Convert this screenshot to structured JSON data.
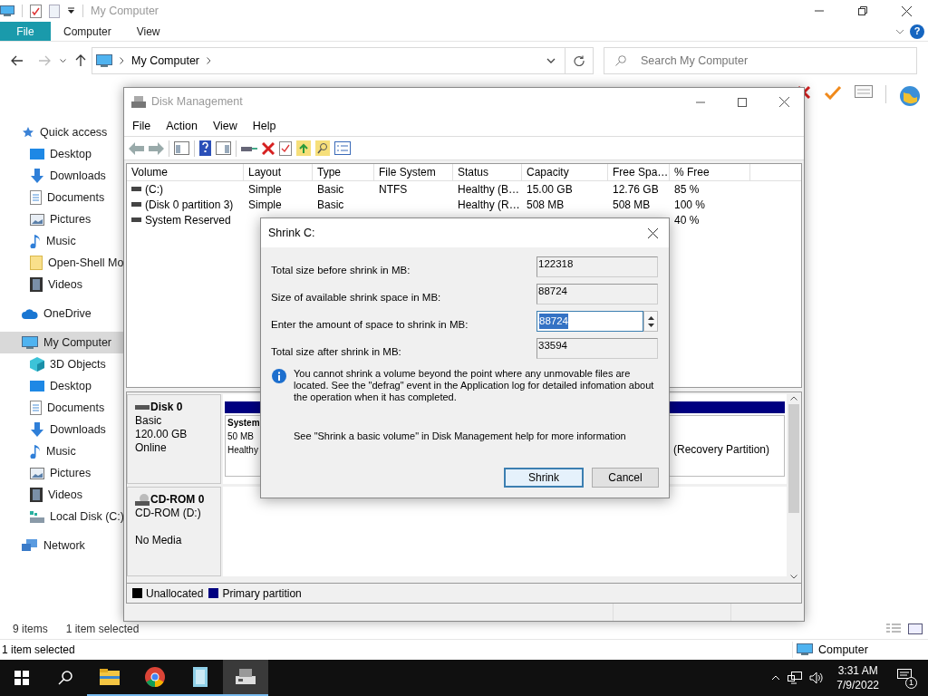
{
  "explorer": {
    "title": "My Computer",
    "ribbon_tabs": [
      {
        "label": "File",
        "selected": true
      },
      {
        "label": "Computer",
        "selected": false
      },
      {
        "label": "View",
        "selected": false
      }
    ],
    "help": "?",
    "address": {
      "path": "My Computer"
    },
    "search": {
      "placeholder": "Search My Computer"
    },
    "nav": [
      {
        "label": "Quick access",
        "selected": false,
        "children": [
          {
            "label": "Desktop",
            "selected": false
          },
          {
            "label": "Downloads",
            "selected": false
          },
          {
            "label": "Documents",
            "selected": false
          },
          {
            "label": "Pictures",
            "selected": false
          },
          {
            "label": "Music",
            "selected": false
          },
          {
            "label": "Open-Shell Mo",
            "selected": false
          },
          {
            "label": "Videos",
            "selected": false
          }
        ]
      },
      {
        "label": "OneDrive",
        "selected": false
      },
      {
        "label": "My Computer",
        "selected": true,
        "children": [
          {
            "label": "3D Objects",
            "selected": false
          },
          {
            "label": "Desktop",
            "selected": false
          },
          {
            "label": "Documents",
            "selected": false
          },
          {
            "label": "Downloads",
            "selected": false
          },
          {
            "label": "Music",
            "selected": false
          },
          {
            "label": "Pictures",
            "selected": false
          },
          {
            "label": "Videos",
            "selected": false
          },
          {
            "label": "Local Disk (C:)",
            "selected": false
          }
        ]
      },
      {
        "label": "Network",
        "selected": false
      }
    ],
    "status": {
      "count": "9 items",
      "selection": "1 item selected"
    }
  },
  "back_window_status": {
    "selection": "1 item selected",
    "location": "Computer"
  },
  "disk_management": {
    "title": "Disk Management",
    "menu": [
      "File",
      "Action",
      "View",
      "Help"
    ],
    "columns": [
      "Volume",
      "Layout",
      "Type",
      "File System",
      "Status",
      "Capacity",
      "Free Spa…",
      "% Free"
    ],
    "rows": [
      {
        "volume": "(C:)",
        "layout": "Simple",
        "type": "Basic",
        "file_system": "NTFS",
        "status": "Healthy (B…",
        "capacity": "15.00 GB",
        "free_space": "12.76 GB",
        "pct_free": "85 %"
      },
      {
        "volume": "(Disk 0 partition 3)",
        "layout": "Simple",
        "type": "Basic",
        "status": "Healthy (R…",
        "capacity": "508 MB",
        "free_space": "508 MB",
        "pct_free": "100 %"
      },
      {
        "volume": "System Reserved",
        "pct_free": "40 %"
      }
    ],
    "disks": [
      {
        "kind": "disk",
        "name": "Disk 0",
        "type": "Basic",
        "size": "120.00 GB",
        "status": "Online",
        "partitions": [
          {
            "name": "System",
            "size": "50 MB",
            "status": "Healthy"
          },
          {
            "status": "(Recovery Partition)"
          }
        ]
      },
      {
        "kind": "cdrom",
        "name": "CD-ROM 0",
        "type": "CD-ROM (D:)",
        "status": "No Media"
      }
    ],
    "legend": [
      {
        "label": "Unallocated",
        "color": "#000000"
      },
      {
        "label": "Primary partition",
        "color": "#000080"
      }
    ]
  },
  "shrink_dialog": {
    "title": "Shrink C:",
    "fields": [
      {
        "label": "Total size before shrink in MB:",
        "value": "122318",
        "kind": "readonly"
      },
      {
        "label": "Size of available shrink space in MB:",
        "value": "88724",
        "kind": "readonly"
      },
      {
        "label": "Enter the amount of space to shrink in MB:",
        "value": "88724",
        "kind": "spin"
      },
      {
        "label": "Total size after shrink in MB:",
        "value": "33594",
        "kind": "readonly"
      }
    ],
    "info": "You cannot shrink a volume beyond the point where any unmovable files are located. See the \"defrag\" event in the Application log for detailed infomation about the operation when it has completed.",
    "help": "See \"Shrink a basic volume\" in Disk Management help for more information",
    "buttons": [
      {
        "label": "Shrink",
        "default": true
      },
      {
        "label": "Cancel",
        "default": false
      }
    ]
  },
  "taskbar": {
    "time": "3:31 AM",
    "date": "7/9/2022",
    "notifications": "1"
  }
}
